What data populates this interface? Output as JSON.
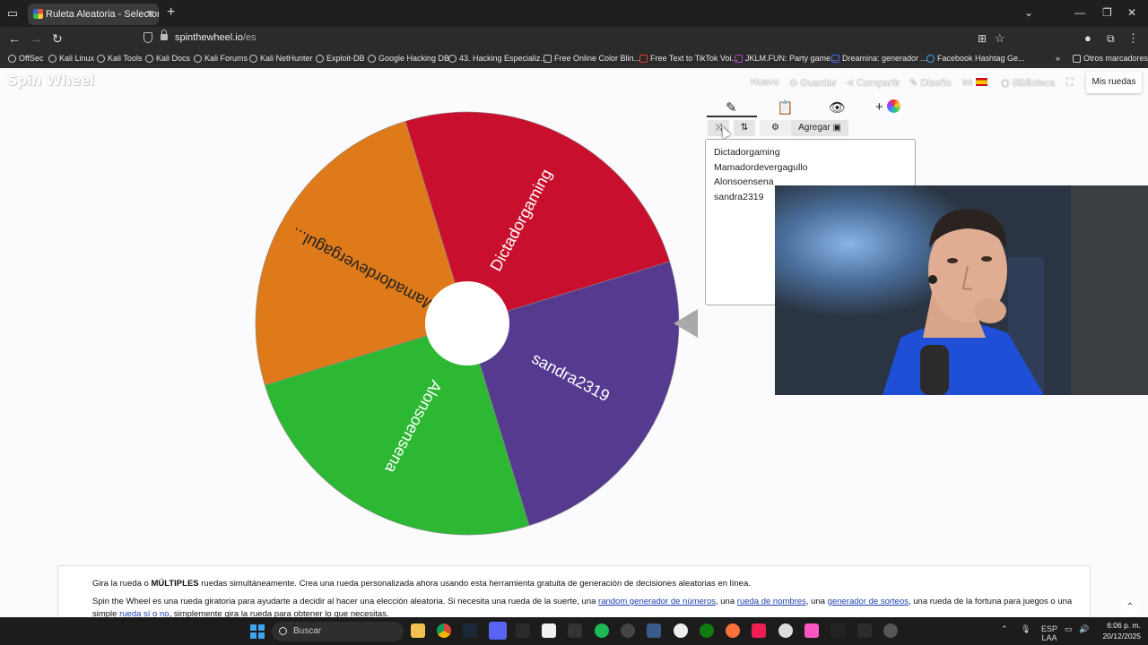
{
  "browser": {
    "tab_title": "Ruleta Aleatoria - Selector Pers",
    "url_host": "spinthewheel.io",
    "url_path": "/es",
    "bookmarks": [
      "OffSec",
      "Kali Linux",
      "Kali Tools",
      "Kali Docs",
      "Kali Forums",
      "Kali NetHunter",
      "Exploit-DB",
      "Google Hacking DB",
      "43. Hacking Especializ...",
      "Free Online Color Blin...",
      "Free Text to TikTok Voi...",
      "JKLM.FUN: Party game...",
      "Dreamina: generador ...",
      "Facebook Hashtag Ge..."
    ],
    "other_bookmarks": "Otros marcadores"
  },
  "site": {
    "logo": "Spin Wheel",
    "nav": {
      "new": "Nuevo",
      "save": "Guardar",
      "share": "Compartir",
      "design": "Diseño",
      "lang": "es",
      "library": "Biblioteca",
      "my_wheels": "Mis ruedas"
    }
  },
  "wheel": {
    "segments": [
      {
        "label": "Dictadorgaming",
        "color": "#c8102e"
      },
      {
        "label": "sandra2319",
        "color": "#553a8f"
      },
      {
        "label": "Alonsoensena",
        "color": "#2db834"
      },
      {
        "label": "Mamadordevergagul...",
        "color": "#df7a1a"
      }
    ],
    "pointer_color": "#a9a9a9"
  },
  "editor": {
    "tools": {
      "add": "Agregar"
    },
    "entries": [
      "Dictadorgaming",
      "Mamadordevergagullo",
      "Alonsoensena",
      "sandra2319"
    ]
  },
  "info": {
    "line1_pre": "Gira la rueda o ",
    "line1_bold": "MÚLTIPLES",
    "line1_post": " ruedas simultáneamente. Crea una rueda personalizada ahora usando esta herramienta gratuita de generación de decisiones aleatorias en línea.",
    "line2_a": "Spin the Wheel es una rueda giratoria para ayudarte a decidir al hacer una elección aleatoria. Si necesita una rueda de la suerte, una ",
    "link1": "random generador de números",
    "line2_b": ", una ",
    "link2": "rueda de nombres",
    "line2_c": ", una ",
    "link3": "generador de sorteos",
    "line2_d": ", una rueda de la fortuna para juegos o una",
    "line3_a": "simple ",
    "link4": "rueda sí o no",
    "line3_b": ", simplemente gira la rueda para obtener lo que necesitas."
  },
  "taskbar": {
    "search": "Buscar",
    "lang_top": "ESP",
    "lang_bottom": "LAA",
    "time": "6:06 p. m.",
    "date": "20/12/2025"
  }
}
